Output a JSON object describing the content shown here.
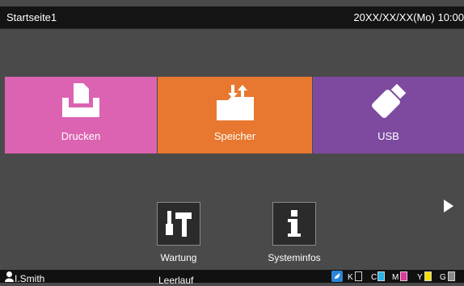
{
  "header": {
    "title": "Startseite1",
    "datetime": "20XX/XX/XX(Mo) 10:00"
  },
  "tiles": [
    {
      "label": "Drucken",
      "icon": "print-tray-icon",
      "color": "#dc63b2"
    },
    {
      "label": "Speicher",
      "icon": "folder-transfer-icon",
      "color": "#e8782f"
    },
    {
      "label": "USB",
      "icon": "usb-stick-icon",
      "color": "#7e4aa0"
    }
  ],
  "small_tiles": [
    {
      "label": "Wartung",
      "icon": "tools-icon"
    },
    {
      "label": "Systeminfos",
      "icon": "info-icon"
    }
  ],
  "status": {
    "user": "I.Smith",
    "state": "Leerlauf",
    "inks": [
      {
        "label": "K",
        "color": "#111111"
      },
      {
        "label": "C",
        "color": "#2bb3e6"
      },
      {
        "label": "M",
        "color": "#e0389e"
      },
      {
        "label": "Y",
        "color": "#f4e100"
      },
      {
        "label": "G",
        "color": "#8a8a8a"
      }
    ]
  }
}
